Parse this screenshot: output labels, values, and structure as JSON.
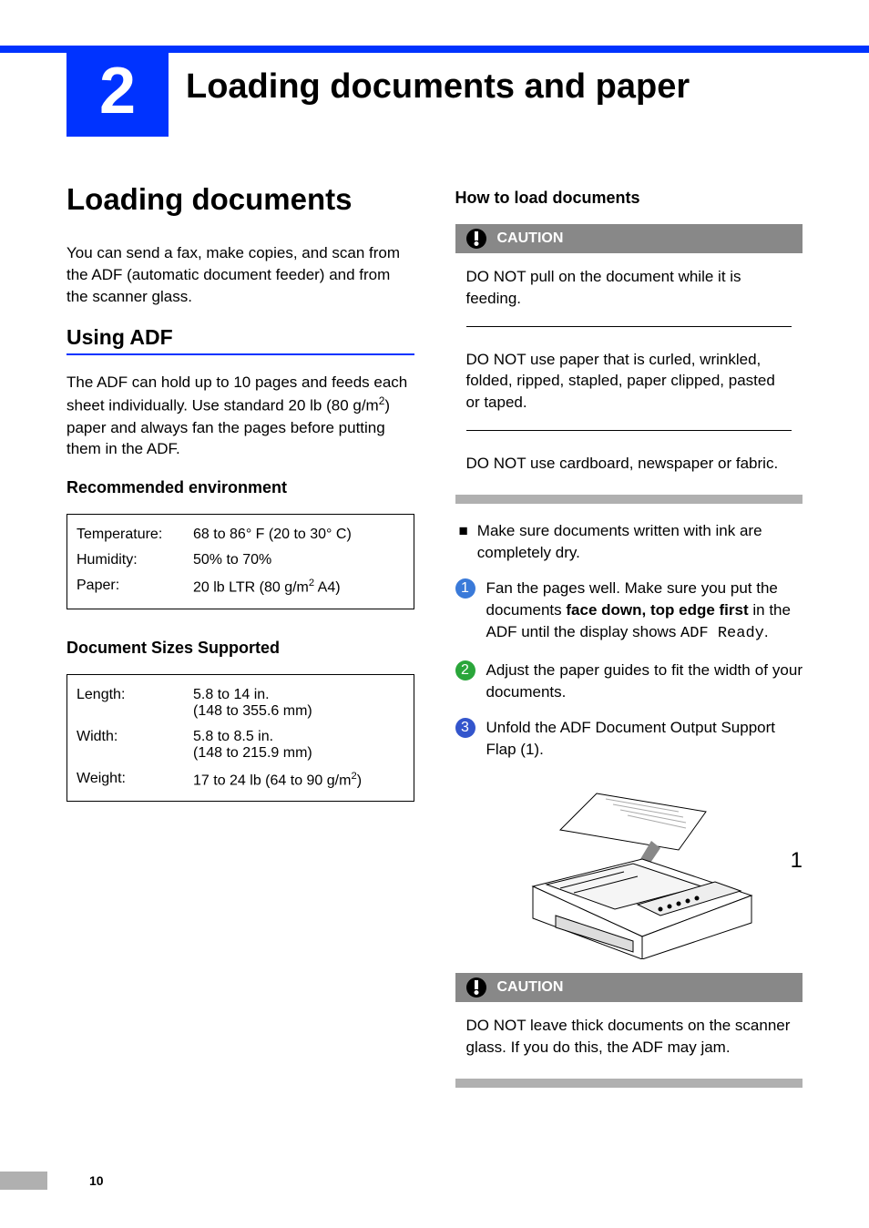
{
  "chapter": {
    "number": "2",
    "title": "Loading documents and paper"
  },
  "leftCol": {
    "h1": "Loading documents",
    "intro": "You can send a fax, make copies, and scan from the ADF (automatic document feeder) and from the scanner glass.",
    "h2": "Using ADF",
    "adf_p1_a": "The ADF can hold up to 10 pages and feeds each sheet individually. Use standard 20 lb (80 g/m",
    "adf_p1_b": ") paper and always fan the pages before putting them in the ADF.",
    "h3_env": "Recommended environment",
    "env": {
      "temp_label": "Temperature:",
      "temp_value": "68 to 86° F (20 to 30° C)",
      "humidity_label": "Humidity:",
      "humidity_value": "50% to 70%",
      "paper_label": "Paper:",
      "paper_value_a": "20 lb LTR (80 g/m",
      "paper_value_b": "  A4)"
    },
    "h3_sizes": "Document Sizes Supported",
    "sizes": {
      "length_label": "Length:",
      "length_value": "5.8 to 14 in.\n(148 to 355.6 mm)",
      "width_label": "Width:",
      "width_value": "5.8 to 8.5 in.\n(148 to 215.9 mm)",
      "weight_label": "Weight:",
      "weight_value_a": "17 to 24 lb (64 to 90 g/m",
      "weight_value_b": ")"
    }
  },
  "rightCol": {
    "h3_howto": "How to load documents",
    "caution_label": "CAUTION",
    "caution1_a": "DO NOT pull on the document while it is feeding.",
    "caution1_b": "DO NOT use paper that is curled, wrinkled, folded, ripped, stapled, paper clipped, pasted or taped.",
    "caution1_c": "DO NOT use cardboard, newspaper or fabric.",
    "bullet1": "Make sure documents written with ink are completely dry.",
    "step1_a": "Fan the pages well. Make sure you put the documents ",
    "step1_b": "face down, top edge first",
    "step1_c": " in the ADF until the display shows ",
    "step1_d": "ADF Ready",
    "step1_e": ".",
    "step2": "Adjust the paper guides to fit the width of your documents.",
    "step3": "Unfold the ADF Document Output Support Flap (1).",
    "diagram_label": "1",
    "caution2": "DO NOT leave thick documents on the scanner glass. If you do this, the ADF may jam."
  },
  "pageNumber": "10"
}
